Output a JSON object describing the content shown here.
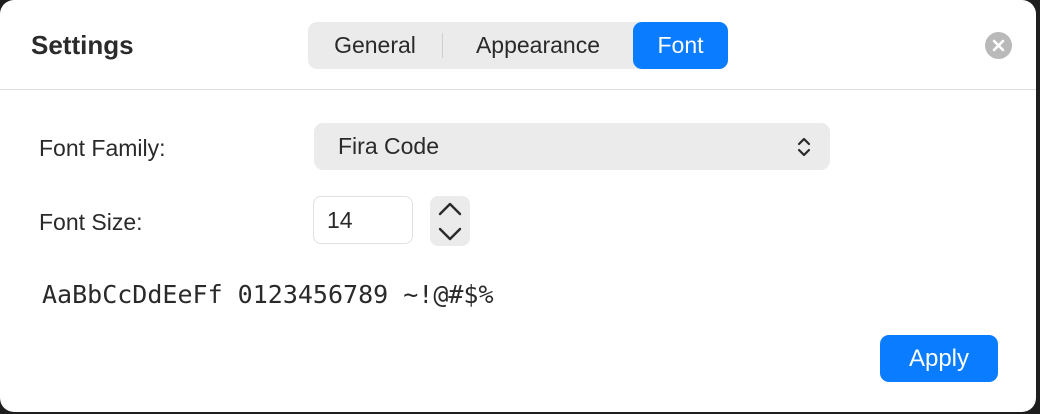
{
  "window": {
    "title": "Settings"
  },
  "tabs": [
    {
      "label": "General",
      "selected": false
    },
    {
      "label": "Appearance",
      "selected": false
    },
    {
      "label": "Font",
      "selected": true
    }
  ],
  "font_family": {
    "label": "Font Family:",
    "value": "Fira Code"
  },
  "font_size": {
    "label": "Font Size:",
    "value": "14"
  },
  "preview": {
    "text": "AaBbCcDdEeFf 0123456789 ~!@#$%"
  },
  "actions": {
    "apply_label": "Apply"
  },
  "colors": {
    "accent": "#0a7cff",
    "control_bg": "#ebebeb",
    "close_button": "#b9b9b9"
  },
  "icons": {
    "close": "close-icon",
    "select": "chevron-up-down-icon",
    "step_up": "chevron-up-icon",
    "step_down": "chevron-down-icon"
  }
}
